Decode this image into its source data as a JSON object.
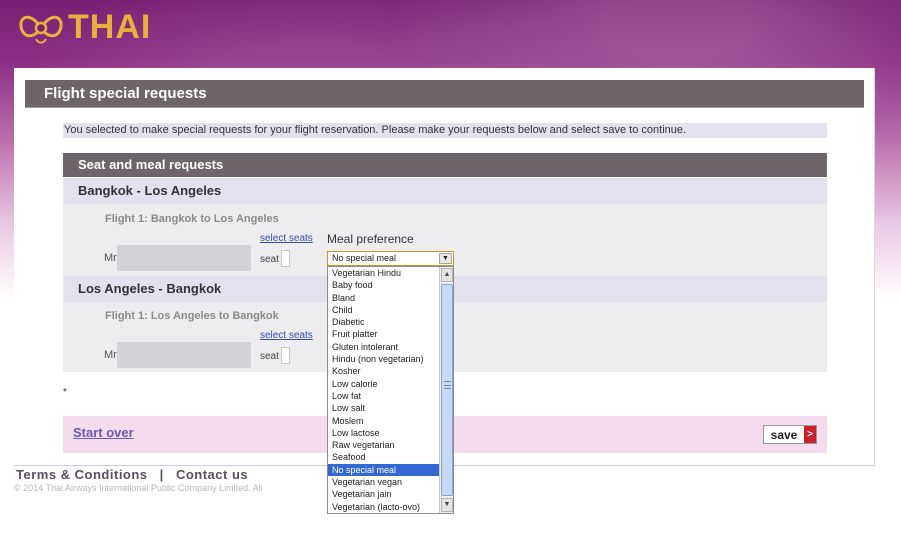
{
  "brand": {
    "logo_text": "THAI",
    "logo_color": "#e8b13a",
    "header_color": "#7a1f73"
  },
  "page": {
    "title": "Flight special requests",
    "intro": "You selected to make special requests for your flight reservation. Please make your requests below and select save to continue."
  },
  "section": {
    "title": "Seat and meal requests"
  },
  "routes": [
    {
      "route": "Bangkok - Los Angeles",
      "flight": "Flight 1: Bangkok to Los Angeles",
      "select_seats": "select seats",
      "meal_preference_label": "Meal preference",
      "passenger_title": "Mr",
      "seat_label": "seat"
    },
    {
      "route": "Los Angeles - Bangkok",
      "flight": "Flight 1: Los Angeles to Bangkok",
      "select_seats": "select seats",
      "passenger_title": "Mr",
      "seat_label": "seat"
    }
  ],
  "meal_select": {
    "selected": "No special meal",
    "options": [
      "Vegetarian Hindu",
      "Baby food",
      "Bland",
      "Child",
      "Diabetic",
      "Fruit platter",
      "Gluten intolerant",
      "Hindu (non vegetarian)",
      "Kosher",
      "Low calorie",
      "Low fat",
      "Low salt",
      "Moslem",
      "Low lactose",
      "Raw vegetarian",
      "Seafood",
      "No special meal",
      "Vegetarian vegan",
      "Vegetarian jain",
      "Vegetarian (lacto-ovo)"
    ]
  },
  "footnote": "*",
  "actions": {
    "start_over": "Start over",
    "save": "save",
    "save_arrow": ">"
  },
  "footer": {
    "terms": "Terms & Conditions",
    "separator": "|",
    "contact": "Contact us",
    "copyright": "© 2014 Thai Airways International Public Company Limited. All"
  }
}
